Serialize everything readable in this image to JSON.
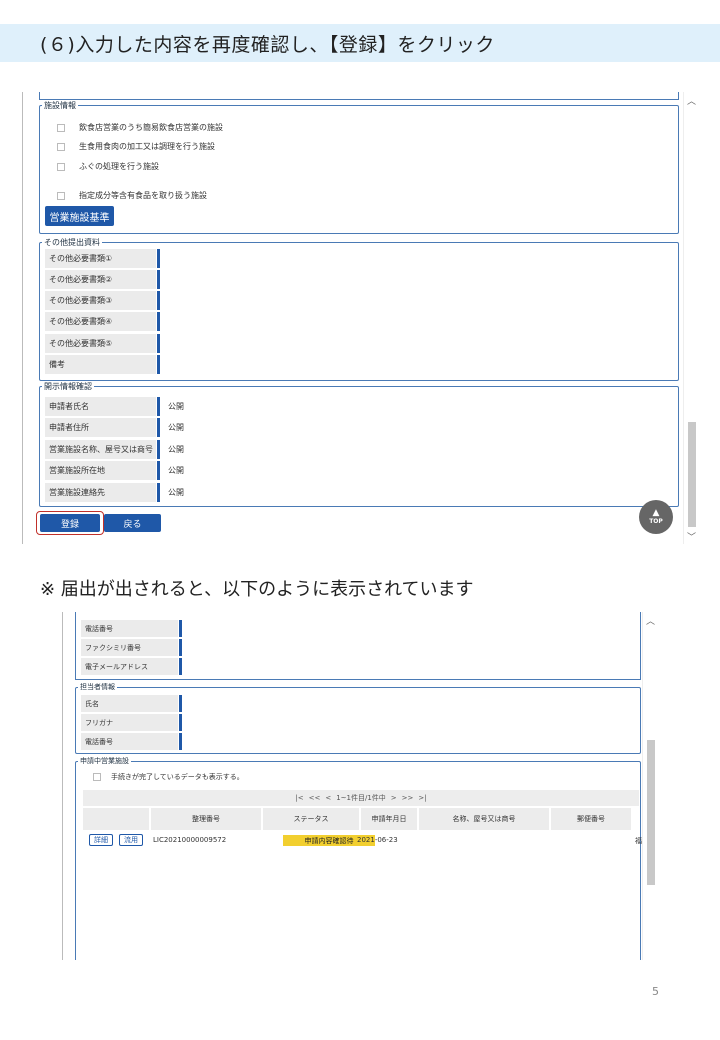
{
  "header": {
    "title": "(６)入力した内容を再度確認し、【登録】をクリック",
    "band_color": "#dff0fb"
  },
  "form1": {
    "facility_section": {
      "legend": "施設情報",
      "checkboxes": [
        "飲食店営業のうち簡易飲食店営業の施設",
        "生食用食肉の加工又は調理を行う施設",
        "ふぐの処理を行う施設",
        "指定成分等含有食品を取り扱う施設"
      ],
      "standards_button": "営業施設基準"
    },
    "other_docs_section": {
      "legend": "その他提出資料",
      "rows": [
        "その他必要書類①",
        "その他必要書類②",
        "その他必要書類③",
        "その他必要書類④",
        "その他必要書類⑤",
        "備考"
      ]
    },
    "disclosure_section": {
      "legend": "開示情報確認",
      "rows": [
        {
          "label": "申請者氏名",
          "value": "公開"
        },
        {
          "label": "申請者住所",
          "value": "公開"
        },
        {
          "label": "営業施設名称、屋号又は商号",
          "value": "公開"
        },
        {
          "label": "営業施設所在地",
          "value": "公開"
        },
        {
          "label": "営業施設連絡先",
          "value": "公開"
        }
      ]
    },
    "register_button": "登録",
    "back_button": "戻る",
    "top_button": "TOP",
    "accent_color": "#1f58a8",
    "highlight_color": "#c0302a"
  },
  "note": "※ 届出が出されると、以下のように表示されています",
  "form2": {
    "contact_rows": [
      "電話番号",
      "ファクシミリ番号",
      "電子メールアドレス"
    ],
    "person_section": {
      "legend": "担当者情報",
      "rows": [
        "氏名",
        "フリガナ",
        "電話番号"
      ]
    },
    "applications_section": {
      "legend": "申請中営業施設",
      "checkbox": "手続きが完了しているデータも表示する。",
      "pager": {
        "first": "|<",
        "prev_prev": "<<",
        "prev": "<",
        "info": "1~1件目/1件中",
        "next": ">",
        "next_next": ">>",
        "last": ">|"
      },
      "columns": [
        "整理番号",
        "ステータス",
        "申請年月日",
        "名称、屋号又は商号",
        "郵便番号"
      ],
      "row": {
        "detail_button": "詳細",
        "use_button": "流用",
        "number": "LIC20210000009572",
        "status": "申請内容確認待",
        "date": "2021-06-23",
        "postal_cut": "福"
      },
      "status_color": "#f2cf2f"
    }
  },
  "page_number": "5"
}
